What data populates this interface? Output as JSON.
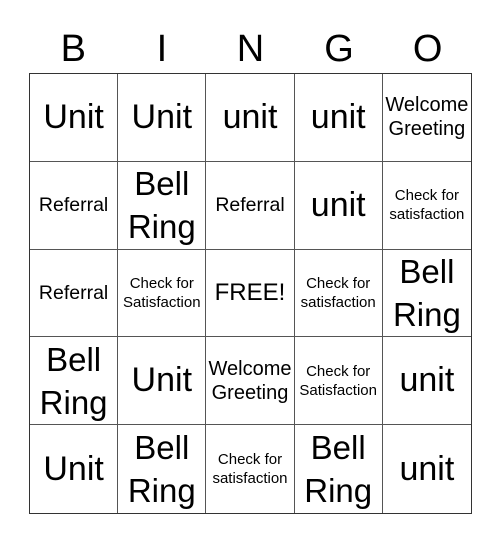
{
  "header": [
    "B",
    "I",
    "N",
    "G",
    "O"
  ],
  "cells": [
    {
      "text": "Unit",
      "size": "xl"
    },
    {
      "text": "Unit",
      "size": "xl"
    },
    {
      "text": "unit",
      "size": "xl"
    },
    {
      "text": "unit",
      "size": "xl"
    },
    {
      "text": "Welcome Greeting",
      "size": "m"
    },
    {
      "text": "Referral",
      "size": "ref"
    },
    {
      "text": "Bell Ring",
      "size": "l"
    },
    {
      "text": "Referral",
      "size": "ref"
    },
    {
      "text": "unit",
      "size": "xl"
    },
    {
      "text": "Check for satisfaction",
      "size": "s"
    },
    {
      "text": "Referral",
      "size": "ref"
    },
    {
      "text": "Check for Satisfaction",
      "size": "s"
    },
    {
      "text": "FREE!",
      "size": "free"
    },
    {
      "text": "Check for satisfaction",
      "size": "s"
    },
    {
      "text": "Bell Ring",
      "size": "l"
    },
    {
      "text": "Bell Ring",
      "size": "l"
    },
    {
      "text": "Unit",
      "size": "xl"
    },
    {
      "text": "Welcome Greeting",
      "size": "m"
    },
    {
      "text": "Check for Satisfaction",
      "size": "s"
    },
    {
      "text": "unit",
      "size": "xl"
    },
    {
      "text": "Unit",
      "size": "xl"
    },
    {
      "text": "Bell Ring",
      "size": "l"
    },
    {
      "text": "Check for satisfaction",
      "size": "s"
    },
    {
      "text": "Bell Ring",
      "size": "l"
    },
    {
      "text": "unit",
      "size": "xl"
    }
  ]
}
